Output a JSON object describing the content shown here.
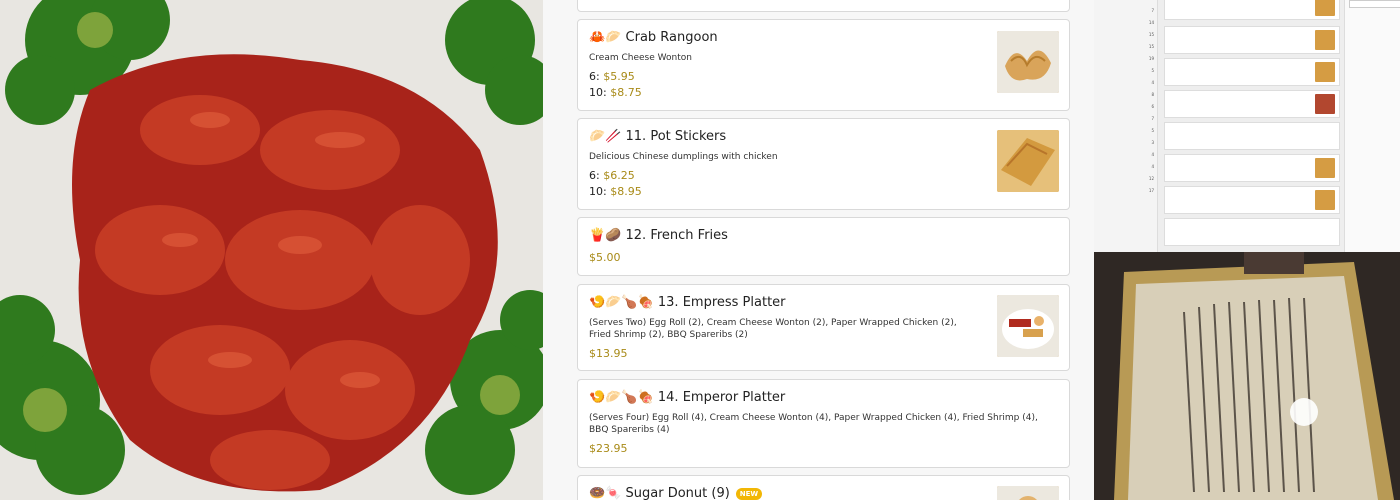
{
  "menu": {
    "items": [
      {
        "icon": "🦀🥟",
        "title": "Crab Rangoon",
        "description": "Cream Cheese Wonton",
        "prices": [
          {
            "label": "6:",
            "amount": "$5.95"
          },
          {
            "label": "10:",
            "amount": "$8.75"
          }
        ]
      },
      {
        "icon": "🥟🥢",
        "title": "11. Pot Stickers",
        "description": "Delicious Chinese dumplings with chicken",
        "prices": [
          {
            "label": "6:",
            "amount": "$6.25"
          },
          {
            "label": "10:",
            "amount": "$8.95"
          }
        ]
      },
      {
        "icon": "🍟🥔",
        "title": "12. French Fries",
        "prices": [
          {
            "label": "",
            "amount": "$5.00"
          }
        ]
      },
      {
        "icon": "🍤🥟🍗🍖",
        "title": "13. Empress Platter",
        "description": "(Serves Two) Egg Roll (2), Cream Cheese Wonton (2), Paper Wrapped Chicken (2), Fried Shrimp (2), BBQ Spareribs (2)",
        "prices": [
          {
            "label": "",
            "amount": "$13.95"
          }
        ]
      },
      {
        "icon": "🍤🥟🍗🍖",
        "title": "14. Emperor Platter",
        "description": "(Serves Four) Egg Roll (4), Cream Cheese Wonton (4), Paper Wrapped Chicken (4), Fried Shrimp (4), BBQ Spareribs (4)",
        "prices": [
          {
            "label": "",
            "amount": "$23.95"
          }
        ]
      },
      {
        "icon": "🍩🍬",
        "title": "Sugar Donut (9)",
        "badge": "NEW"
      }
    ]
  },
  "colors": {
    "price_accent": "#a88a17",
    "badge": "#f2b705"
  }
}
